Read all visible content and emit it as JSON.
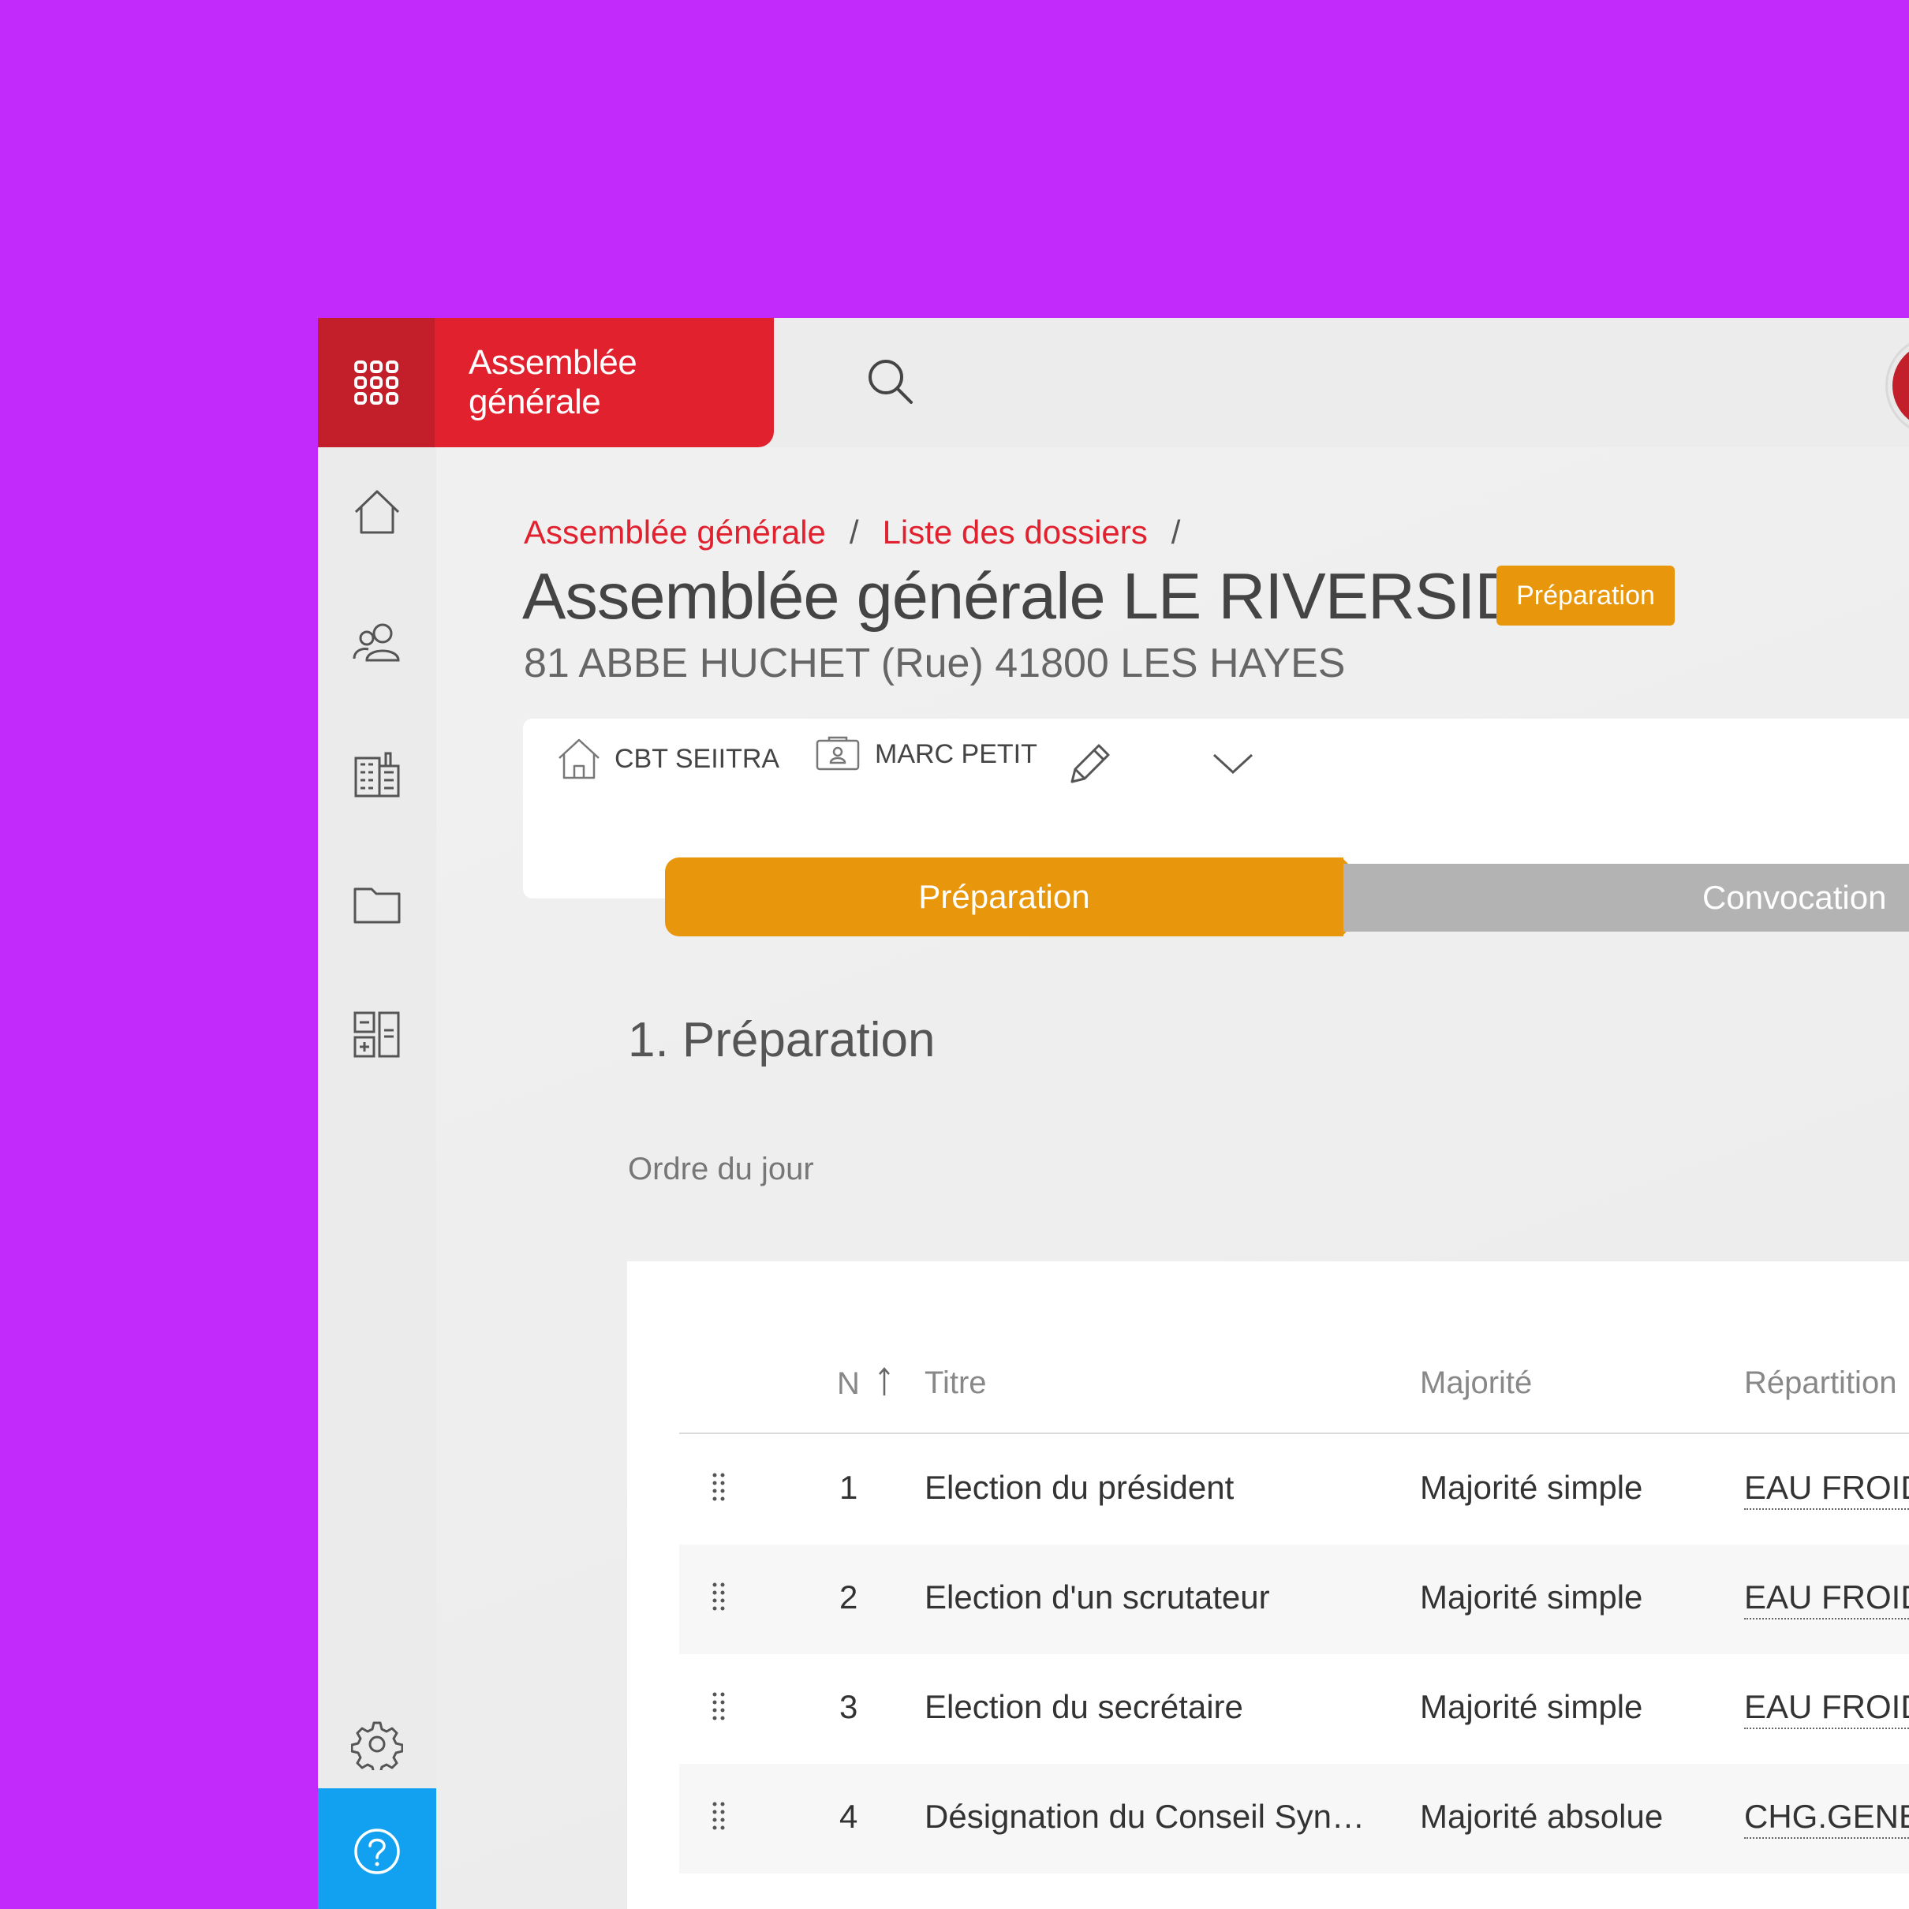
{
  "app": {
    "title": "Assemblée générale"
  },
  "breadcrumb": {
    "items": [
      "Assemblée générale",
      "Liste des dossiers"
    ],
    "separator": "/"
  },
  "header": {
    "title": "Assemblée générale LE RIVERSIDE",
    "status": "Préparation",
    "address": "81 ABBE HUCHET (Rue) 41800 LES HAYES"
  },
  "info": {
    "building": "CBT SEIITRA",
    "manager": "MARC PETIT"
  },
  "stepper": {
    "active": "Préparation",
    "next": "Convocation"
  },
  "section": {
    "title": "1. Préparation",
    "subtitle": "Ordre du jour"
  },
  "table": {
    "headers": {
      "number": "N",
      "title": "Titre",
      "majority": "Majorité",
      "distribution": "Répartition"
    },
    "rows": [
      {
        "number": "1",
        "title": "Election du président",
        "majority": "Majorité simple",
        "distribution": "EAU FROID"
      },
      {
        "number": "2",
        "title": "Election d'un scrutateur",
        "majority": "Majorité simple",
        "distribution": "EAU FROID"
      },
      {
        "number": "3",
        "title": "Election du secrétaire",
        "majority": "Majorité simple",
        "distribution": "EAU FROID"
      },
      {
        "number": "4",
        "title": "Désignation du Conseil Syn…",
        "majority": "Majorité absolue",
        "distribution": "CHG.GENE."
      }
    ]
  },
  "colors": {
    "brand_red": "#e2212f",
    "brand_dark_red": "#c21f2b",
    "status_orange": "#e8970c",
    "help_blue": "#12a0f0",
    "background": "#c22afc"
  },
  "icons": [
    "apps-grid-icon",
    "search-icon",
    "home-icon",
    "users-icon",
    "building-icon",
    "folder-icon",
    "calculator-icon",
    "gear-icon",
    "help-icon",
    "pencil-icon",
    "chevron-down-icon",
    "contact-card-icon",
    "drag-handle-icon",
    "sort-up-icon"
  ]
}
